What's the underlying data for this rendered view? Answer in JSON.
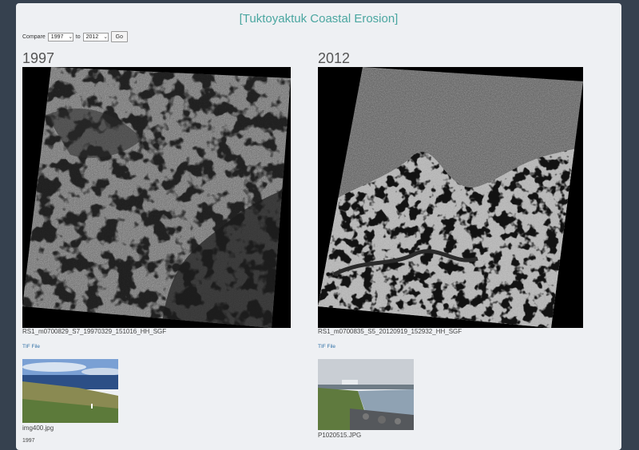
{
  "page": {
    "title": "[Tuktoyaktuk Coastal Erosion]"
  },
  "compare": {
    "label": "Compare",
    "from_value": "1997",
    "to_label": "to",
    "to_value": "2012",
    "go_label": "Go"
  },
  "left": {
    "year": "1997",
    "image_name": "RS1_m0700829_S7_19970329_151016_HH_SGF",
    "tif_label": "TIF File",
    "photo_name": "img400.jpg",
    "photo_year": "1997"
  },
  "right": {
    "year": "2012",
    "image_name": "RS1_m0700835_S5_20120919_152932_HH_SGF",
    "tif_label": "TIF File",
    "photo_name": "P1020515.JPG"
  },
  "colors": {
    "background": "#36414f",
    "panel": "#eef0f3",
    "title": "#4aa6a0",
    "link": "#2f6fa6"
  }
}
